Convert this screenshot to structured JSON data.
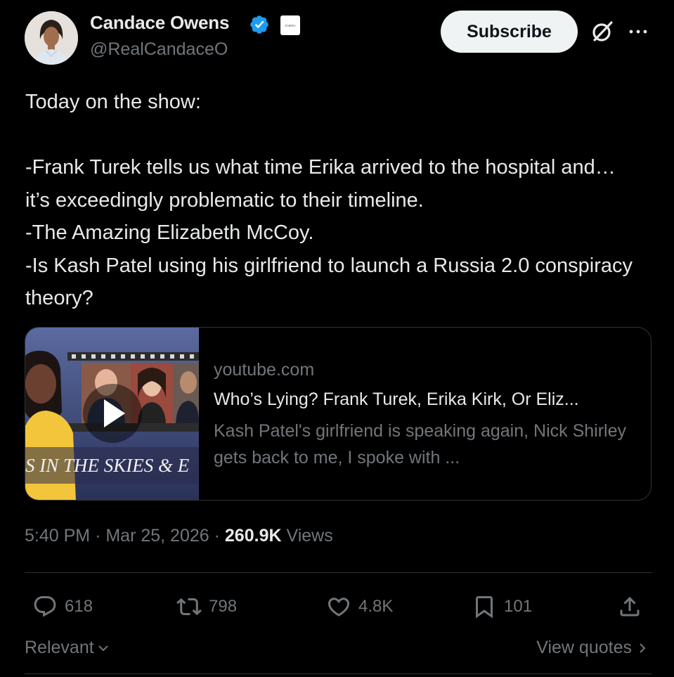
{
  "author": {
    "name": "Candace Owens",
    "handle": "@RealCandaceO",
    "affiliate_badge_text": "FORBES"
  },
  "header": {
    "subscribe_label": "Subscribe",
    "icons": [
      "grok-icon",
      "more-icon",
      "verified-badge-icon"
    ]
  },
  "tweet": {
    "text": "Today on the show:\n\n-Frank Turek tells us what time Erika arrived to the hospital and… it’s exceedingly problematic to their timeline.\n-The Amazing Elizabeth McCoy.\n-Is Kash Patel using his girlfriend to launch a Russia 2.0 conspiracy theory?"
  },
  "link_card": {
    "domain": "youtube.com",
    "title": "Who’s Lying? Frank Turek, Erika Kirk, Or Eliz...",
    "description": "Kash Patel's girlfriend is speaking again, Nick Shirley gets back to me, I spoke with ...",
    "thumbnail_caption": "S IN THE SKIES & E"
  },
  "meta": {
    "time": "5:40 PM",
    "date": "Mar 25, 2026",
    "views_count": "260.9K",
    "views_label": "Views"
  },
  "actions": {
    "replies": "618",
    "reposts": "798",
    "likes": "4.8K",
    "bookmarks": "101"
  },
  "footer": {
    "sort_label": "Relevant",
    "view_quotes_label": "View quotes"
  },
  "colors": {
    "background": "#000000",
    "text_primary": "#e7e9ea",
    "text_secondary": "#71767b",
    "verified_blue": "#1d9bf0",
    "border": "#2f3336"
  }
}
